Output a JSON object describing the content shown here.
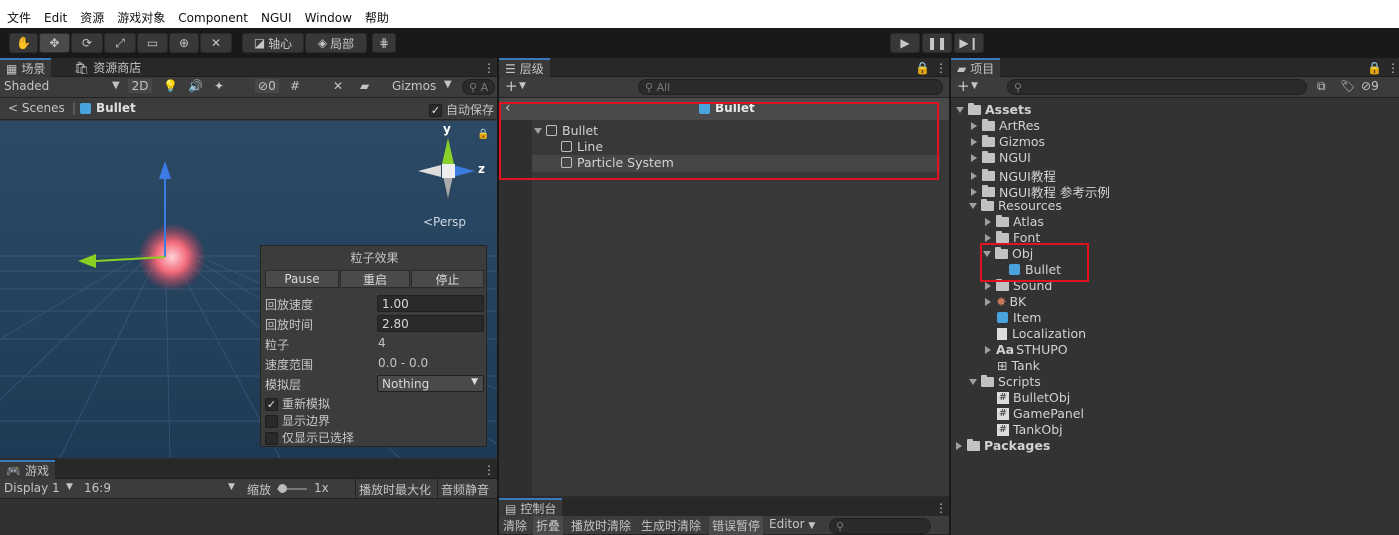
{
  "menu": [
    "文件",
    "Edit",
    "资源",
    "游戏对象",
    "Component",
    "NGUI",
    "Window",
    "帮助"
  ],
  "toolbar": {
    "pivot": "轴心",
    "local": "局部"
  },
  "scene": {
    "tab_scene": "场景",
    "tab_store": "资源商店",
    "shading": "Shaded",
    "mode2d": "2D",
    "hidden_count": "0",
    "gizmos": "Gizmos",
    "search_placeholder": "A",
    "breadcrumb_scenes": "Scenes",
    "breadcrumb_object": "Bullet",
    "autosave": "自动保存",
    "persp": "<Persp",
    "axis_y": "y",
    "axis_z": "z"
  },
  "particle": {
    "title": "粒子效果",
    "pause": "Pause",
    "restart": "重启",
    "stop": "停止",
    "rows": [
      {
        "label": "回放速度",
        "value": "1.00"
      },
      {
        "label": "回放时间",
        "value": "2.80"
      },
      {
        "label": "粒子",
        "value": "4"
      },
      {
        "label": "速度范围",
        "value": "0.0 - 0.0"
      },
      {
        "label": "模拟层",
        "value": "Nothing"
      }
    ],
    "resim": "重新模拟",
    "showbounds": "显示边界",
    "onlysel": "仅显示已选择"
  },
  "game": {
    "tab": "游戏",
    "display": "Display 1",
    "aspect": "16:9",
    "scale_label": "缩放",
    "scale_value": "1x",
    "maximize": "播放时最大化",
    "mute": "音频静音"
  },
  "hierarchy": {
    "tab": "层级",
    "search_placeholder": "All",
    "header": "Bullet",
    "items": [
      "Bullet",
      "Line",
      "Particle System"
    ]
  },
  "console": {
    "tab": "控制台",
    "clear": "清除",
    "collapse": "折叠",
    "clear_on_play": "播放时清除",
    "clear_on_build": "生成时清除",
    "error_pause": "错误暂停",
    "editor": "Editor"
  },
  "project": {
    "tab": "项目",
    "hidden_count": "9",
    "tree": [
      "Assets",
      "ArtRes",
      "Gizmos",
      "NGUI",
      "NGUI教程",
      "NGUI教程 参考示例",
      "Resources",
      "Atlas",
      "Font",
      "Obj",
      "Bullet",
      "Sound",
      "BK",
      "Item",
      "Localization",
      "STHUPO",
      "Tank",
      "Scripts",
      "BulletObj",
      "GamePanel",
      "TankObj",
      "Packages"
    ],
    "font_icon": "Aa",
    "script_icon": "#"
  }
}
